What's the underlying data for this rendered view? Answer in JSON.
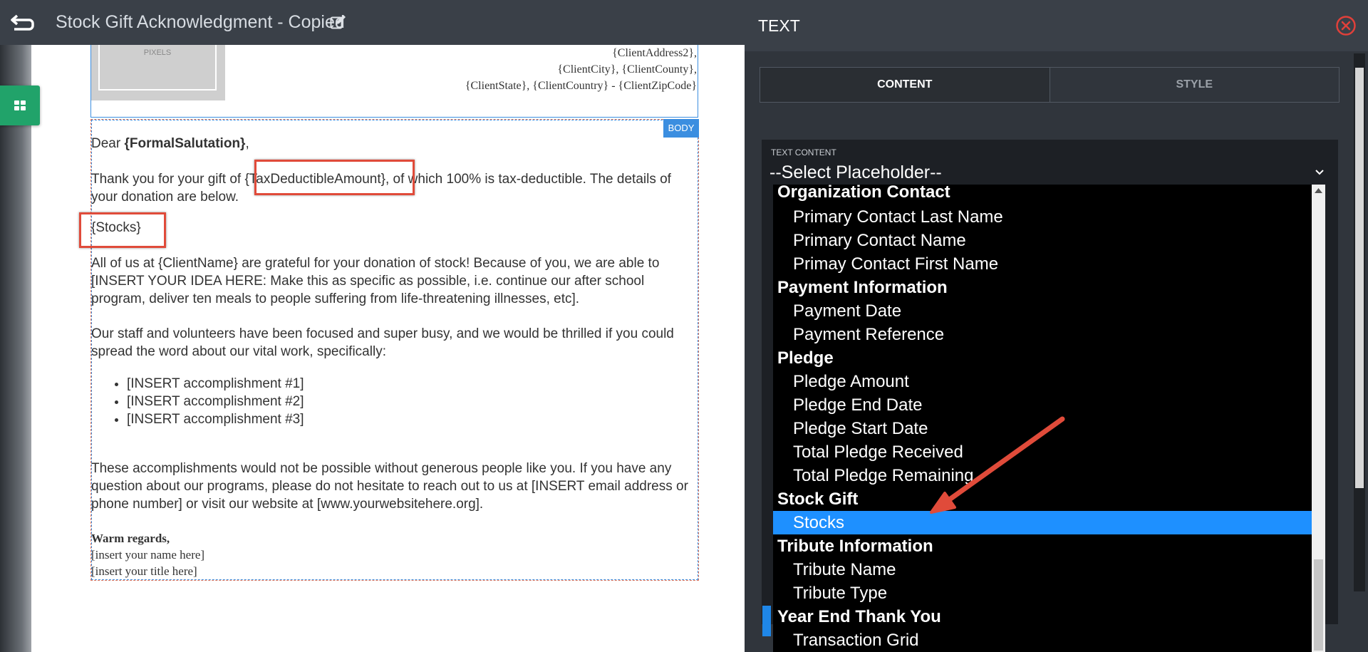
{
  "header": {
    "document_title": "Stock Gift Acknowledgment - Copied"
  },
  "header_block": {
    "logo_label": "PIXELS",
    "address_lines": [
      "{ClientAddress2},",
      "{ClientCity}, {ClientCounty},",
      "{ClientState}, {ClientCountry} - {ClientZipCode}"
    ]
  },
  "body_block": {
    "badge": "BODY",
    "greeting_prefix": "Dear ",
    "greeting_name": "{FormalSalutation}",
    "greeting_suffix": ",",
    "gift_line_prefix": "Thank you for your gift of ",
    "gift_amount": "{TaxDeductibleAmount}",
    "gift_line_suffix": ", of which 100% is tax-deductible. The details of your donation are below.",
    "stocks_placeholder": "{Stocks}",
    "paragraph_gratitude": "All of us at {ClientName} are grateful for your donation of stock! Because of you, we are able to [INSERT YOUR IDEA HERE: Make this as specific as possible, i.e. continue our after school program, deliver ten meals to people suffering from life-threatening illnesses, etc].",
    "paragraph_staff": "Our staff and volunteers have been focused and super busy, and we would be thrilled if you could spread the word about our vital work, specifically:",
    "accomplishments": [
      "[INSERT accomplishment #1]",
      "[INSERT accomplishment #2]",
      "[INSERT accomplishment #3]"
    ],
    "paragraph_contact": "These accomplishments would not be possible without generous people like you. If you have any question about our programs, please do not hesitate to reach out to us at [INSERT email address or phone number] or visit our website at [www.yourwebsitehere.org].",
    "closing": "Warm regards,",
    "signature_name": "[insert your name here]",
    "signature_title": "[insert your title here]"
  },
  "panel": {
    "title": "TEXT",
    "tabs": [
      {
        "label": "CONTENT",
        "active": true
      },
      {
        "label": "STYLE",
        "active": false
      }
    ],
    "text_content_label": "TEXT CONTENT",
    "select_value": "--Select Placeholder--"
  },
  "dropdown": {
    "items": [
      {
        "type": "group",
        "label": "Organization Contact"
      },
      {
        "type": "option",
        "label": "Primary Contact Last Name"
      },
      {
        "type": "option",
        "label": "Primary Contact Name"
      },
      {
        "type": "option",
        "label": "Primay Contact First Name"
      },
      {
        "type": "group",
        "label": "Payment Information"
      },
      {
        "type": "option",
        "label": "Payment Date"
      },
      {
        "type": "option",
        "label": "Payment Reference"
      },
      {
        "type": "group",
        "label": "Pledge"
      },
      {
        "type": "option",
        "label": "Pledge Amount"
      },
      {
        "type": "option",
        "label": "Pledge End Date"
      },
      {
        "type": "option",
        "label": "Pledge Start Date"
      },
      {
        "type": "option",
        "label": "Total Pledge Received"
      },
      {
        "type": "option",
        "label": "Total Pledge Remaining"
      },
      {
        "type": "group",
        "label": "Stock Gift"
      },
      {
        "type": "option",
        "label": "Stocks",
        "selected": true
      },
      {
        "type": "group",
        "label": "Tribute Information"
      },
      {
        "type": "option",
        "label": "Tribute Name"
      },
      {
        "type": "option",
        "label": "Tribute Type"
      },
      {
        "type": "group",
        "label": "Year End Thank You"
      },
      {
        "type": "option",
        "label": "Transaction Grid"
      }
    ]
  },
  "colors": {
    "topbar": "#3a4048",
    "highlight_box": "#e04b3a",
    "selected_option": "#1e90ff",
    "body_badge": "#3b8ee0",
    "layout_tab": "#21a36a"
  }
}
